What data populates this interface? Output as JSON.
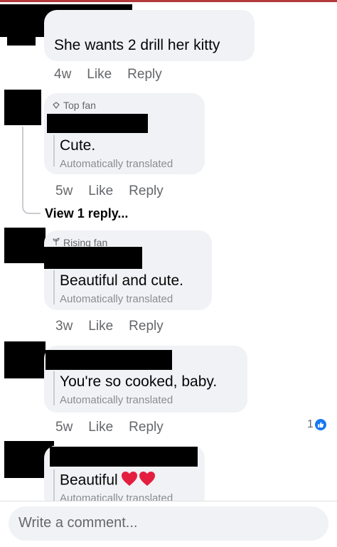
{
  "comments": [
    {
      "text": "She wants 2 drill her kitty",
      "time": "4w",
      "like": "Like",
      "reply": "Reply"
    },
    {
      "badge": "Top fan",
      "text": "Cute.",
      "translated": "Automatically translated",
      "time": "5w",
      "like": "Like",
      "reply": "Reply"
    },
    {
      "badge": "Rising fan",
      "text": "Beautiful and cute.",
      "translated": "Automatically translated",
      "time": "3w",
      "like": "Like",
      "reply": "Reply"
    },
    {
      "text": "You're so cooked, baby.",
      "translated": "Automatically translated",
      "time": "5w",
      "like": "Like",
      "reply": "Reply",
      "reaction_count": "1"
    },
    {
      "text": "Beautiful",
      "translated": "Automatically translated",
      "emoji": [
        "red-heart-icon",
        "red-heart-icon"
      ]
    }
  ],
  "view_replies": "View 1 reply...",
  "composer": {
    "placeholder": "Write a comment..."
  },
  "colors": {
    "bubble": "#f0f2f5",
    "meta": "#65676b",
    "translated": "#8a8d91",
    "like_badge": "#1877f2",
    "heart": "#e41e3f"
  }
}
